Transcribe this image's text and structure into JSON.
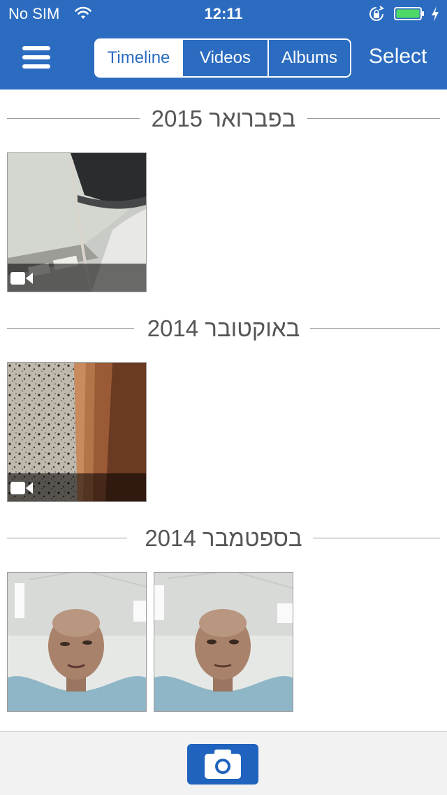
{
  "status_bar": {
    "carrier": "No SIM",
    "time": "12:11",
    "battery_color": "#4cd964"
  },
  "nav": {
    "menu_icon": "hamburger-menu-icon",
    "tabs": [
      {
        "label": "Timeline",
        "active": true
      },
      {
        "label": "Videos",
        "active": false
      },
      {
        "label": "Albums",
        "active": false
      }
    ],
    "select_label": "Select",
    "accent_color": "#2b6cc0"
  },
  "sections": [
    {
      "title": "בפברואר 2015",
      "items": [
        {
          "type": "video"
        }
      ]
    },
    {
      "title": "באוקטובר 2014",
      "items": [
        {
          "type": "video"
        }
      ]
    },
    {
      "title": "בספטמבר 2014",
      "items": [
        {
          "type": "photo"
        },
        {
          "type": "photo"
        }
      ]
    }
  ],
  "toolbar": {
    "camera_icon": "camera-icon"
  }
}
